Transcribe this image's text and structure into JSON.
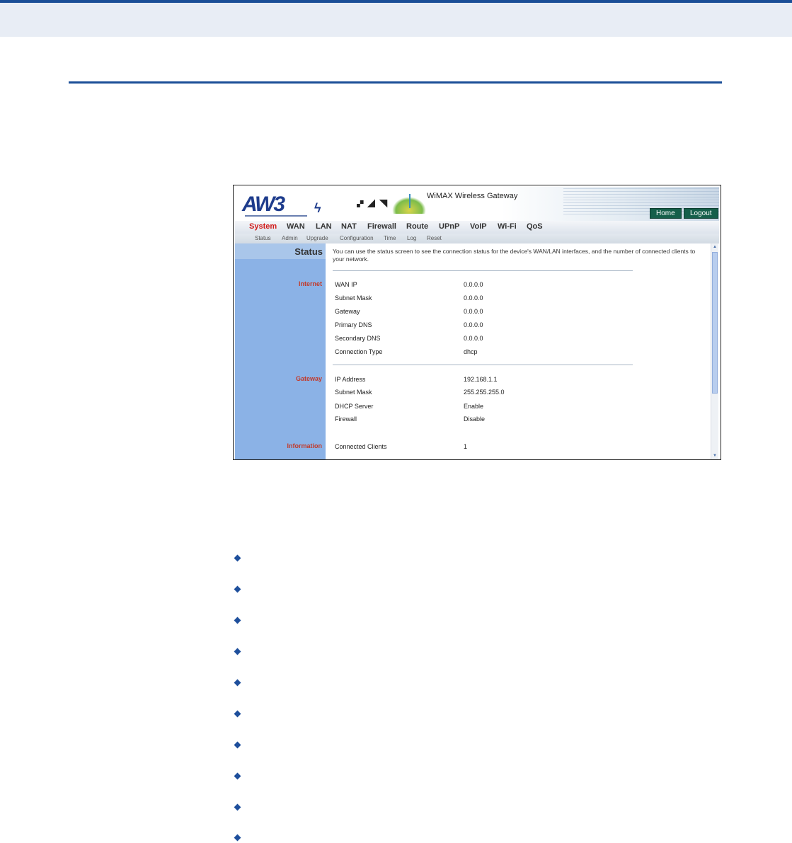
{
  "router": {
    "logo": "AW3",
    "title": "WiMAX Wireless Gateway",
    "home_label": "Home",
    "logout_label": "Logout",
    "nav": [
      "System",
      "WAN",
      "LAN",
      "NAT",
      "Firewall",
      "Route",
      "UPnP",
      "VoIP",
      "Wi-Fi",
      "QoS"
    ],
    "active_nav": "System",
    "subnav": [
      "Status",
      "Admin",
      "Upgrade",
      "Configuration",
      "Time",
      "Log",
      "Reset"
    ],
    "page_label": "Status",
    "description": "You can use the status screen to see the connection status for the device's WAN/LAN interfaces, and the number of connected clients to your network.",
    "sections": [
      {
        "name": "Internet",
        "rows": [
          {
            "label": "WAN IP",
            "value": "0.0.0.0"
          },
          {
            "label": "Subnet Mask",
            "value": "0.0.0.0"
          },
          {
            "label": "Gateway",
            "value": "0.0.0.0"
          },
          {
            "label": "Primary DNS",
            "value": "0.0.0.0"
          },
          {
            "label": "Secondary DNS",
            "value": "0.0.0.0"
          },
          {
            "label": "Connection Type",
            "value": "dhcp"
          }
        ]
      },
      {
        "name": "Gateway",
        "rows": [
          {
            "label": "IP Address",
            "value": "192.168.1.1"
          },
          {
            "label": "Subnet Mask",
            "value": "255.255.255.0"
          },
          {
            "label": "DHCP Server",
            "value": "Enable"
          },
          {
            "label": "Firewall",
            "value": "Disable"
          }
        ]
      },
      {
        "name": "Information",
        "rows": [
          {
            "label": "Connected Clients",
            "value": "1"
          }
        ]
      }
    ]
  },
  "bullet_count": 10,
  "colors": {
    "accent_blue": "#1a4e97",
    "active_nav": "#d11a1a",
    "sidebar": "#8bb2e6",
    "section_label": "#c23a2a",
    "button_green": "#155f4a"
  }
}
